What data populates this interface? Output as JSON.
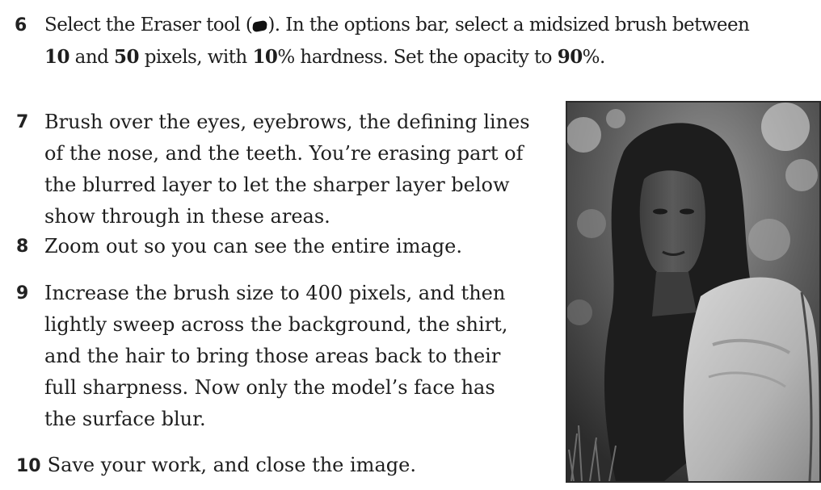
{
  "steps": [
    {
      "number": "6",
      "lines": [
        [
          "Select the Eraser tool (",
          "). In the options bar, select a midsized brush between"
        ],
        [
          "10",
          " and ",
          "50",
          " pixels, with ",
          "10",
          "% hardness. Set the opacity to ",
          "90",
          "%."
        ]
      ]
    },
    {
      "number": "7",
      "lines": [
        "Brush over the eyes, eyebrows, the defining lines",
        "of the nose, and the teeth. You’re erasing part of",
        "the blurred layer to let the sharper layer below",
        "show through in these areas."
      ]
    },
    {
      "number": "8",
      "lines": [
        "Zoom out so you can see the entire image."
      ]
    },
    {
      "number": "9",
      "lines": [
        "Increase the brush size to 400 pixels, and then",
        "lightly sweep across the background, the shirt,",
        "and the hair to bring those areas back to their",
        "full sharpness. Now only the model’s face has",
        "the surface blur."
      ]
    },
    {
      "number": "10",
      "lines": [
        "Save your work, and close the image."
      ]
    }
  ],
  "icons": {
    "eraser": "eraser-tool-icon"
  }
}
